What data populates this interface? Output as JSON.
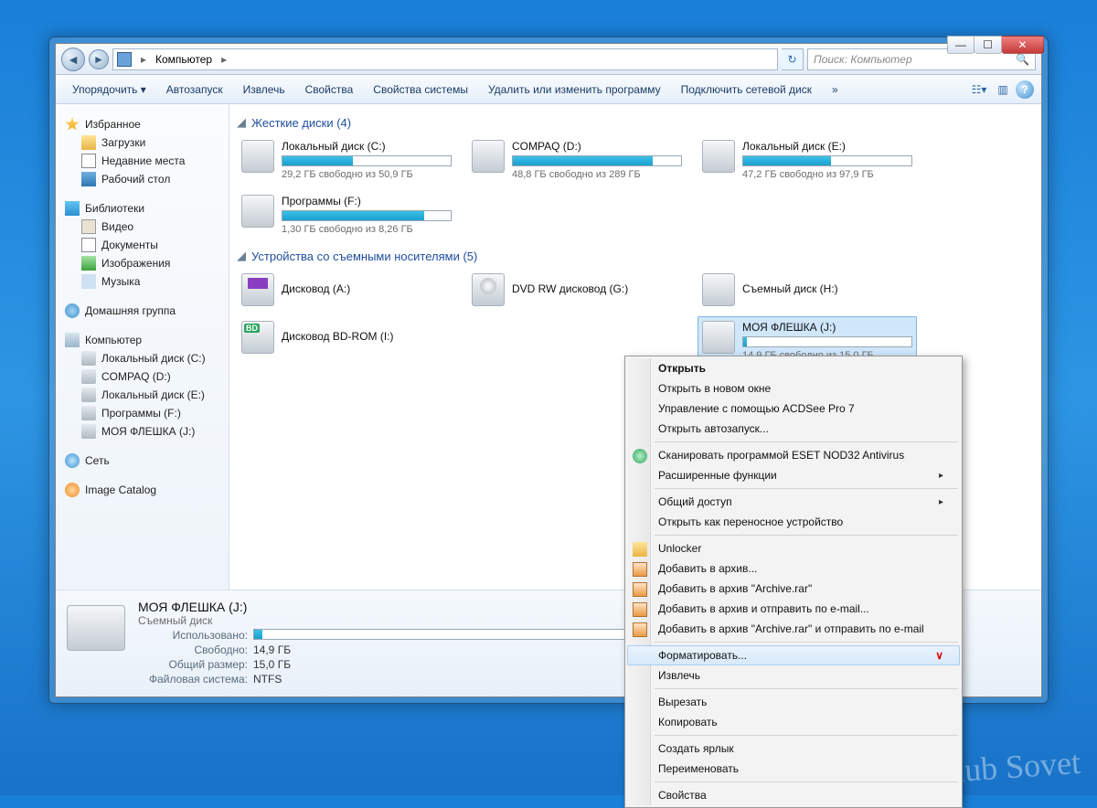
{
  "window": {
    "location": "Компьютер",
    "search_placeholder": "Поиск: Компьютер"
  },
  "toolbar": {
    "organize": "Упорядочить ▾",
    "autoplay": "Автозапуск",
    "eject": "Извлечь",
    "properties": "Свойства",
    "sys_properties": "Свойства системы",
    "uninstall": "Удалить или изменить программу",
    "map_drive": "Подключить сетевой диск",
    "overflow": "»"
  },
  "sidebar": {
    "favorites": "Избранное",
    "downloads": "Загрузки",
    "recent": "Недавние места",
    "desktop": "Рабочий стол",
    "libraries": "Библиотеки",
    "video": "Видео",
    "documents": "Документы",
    "pictures": "Изображения",
    "music": "Музыка",
    "homegroup": "Домашняя группа",
    "computer": "Компьютер",
    "drives": {
      "c": "Локальный диск (C:)",
      "d": "COMPAQ (D:)",
      "e": "Локальный диск (E:)",
      "f": "Программы  (F:)",
      "j": "МОЯ ФЛЕШКА (J:)"
    },
    "network": "Сеть",
    "catalog": "Image Catalog"
  },
  "sections": {
    "hdd_title": "Жесткие диски (4)",
    "removable_title": "Устройства со съемными носителями (5)"
  },
  "hdd": {
    "c": {
      "name": "Локальный диск (C:)",
      "sub": "29,2 ГБ свободно из 50,9 ГБ",
      "fill": 42
    },
    "d": {
      "name": "COMPAQ (D:)",
      "sub": "48,8 ГБ свободно из 289 ГБ",
      "fill": 83
    },
    "e": {
      "name": "Локальный диск (E:)",
      "sub": "47,2 ГБ свободно из 97,9 ГБ",
      "fill": 52
    },
    "f": {
      "name": "Программы  (F:)",
      "sub": "1,30 ГБ свободно из 8,26 ГБ",
      "fill": 84
    }
  },
  "removable": {
    "a": {
      "name": "Дисковод (A:)"
    },
    "g": {
      "name": "DVD RW дисковод (G:)"
    },
    "h": {
      "name": "Съемный диск (H:)"
    },
    "i": {
      "name": "Дисковод BD-ROM (I:)"
    },
    "j": {
      "name": "МОЯ ФЛЕШКА (J:)",
      "sub": "14,9 ГБ свободно из 15,0 ГБ",
      "fill": 2
    }
  },
  "details": {
    "title": "МОЯ ФЛЕШКА (J:)",
    "type": "Съемный диск",
    "used_k": "Использовано:",
    "free_k": "Свободно:",
    "free_v": "14,9 ГБ",
    "total_k": "Общий размер:",
    "total_v": "15,0 ГБ",
    "fs_k": "Файловая система:",
    "fs_v": "NTFS",
    "fill": 2
  },
  "ctx": {
    "open": "Открыть",
    "open_new": "Открыть в новом окне",
    "acdsee": "Управление с помощью ACDSee Pro 7",
    "autoplay": "Открыть автозапуск...",
    "eset": "Сканировать программой ESET NOD32 Antivirus",
    "advanced": "Расширенные функции",
    "share": "Общий доступ",
    "portable": "Открыть как переносное устройство",
    "unlocker": "Unlocker",
    "rar1": "Добавить в архив...",
    "rar2": "Добавить в архив \"Archive.rar\"",
    "rar3": "Добавить в архив и отправить по e-mail...",
    "rar4": "Добавить в архив \"Archive.rar\" и отправить по e-mail",
    "format": "Форматировать...",
    "eject": "Извлечь",
    "cut": "Вырезать",
    "copy": "Копировать",
    "shortcut": "Создать ярлык",
    "rename": "Переименовать",
    "props": "Свойства"
  },
  "watermark": "club Sovet"
}
